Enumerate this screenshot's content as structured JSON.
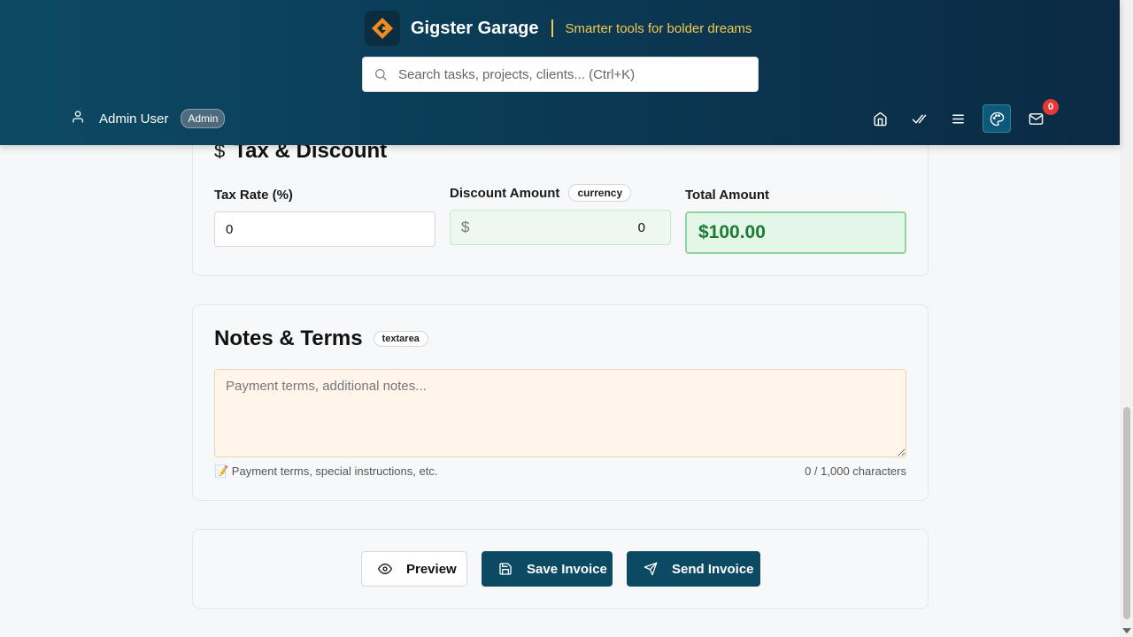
{
  "header": {
    "brand_name": "Gigster Garage",
    "tagline": "Smarter tools for bolder dreams",
    "search_placeholder": "Search tasks, projects, clients... (Ctrl+K)",
    "user_name": "Admin User",
    "role_badge": "Admin",
    "notification_count": "0",
    "nav_icons": [
      "home-icon",
      "tasks-check-icon",
      "menu-icon",
      "palette-icon",
      "mail-icon"
    ],
    "accent_color": "#f2c94c",
    "header_color": "#0b3954"
  },
  "tax_discount": {
    "title": "Tax & Discount",
    "tax_rate_label": "Tax Rate (%)",
    "tax_rate_value": "0",
    "discount_label": "Discount Amount",
    "discount_tag": "currency",
    "discount_currency": "$",
    "discount_value": "0",
    "total_label": "Total Amount",
    "total_value": "$100.00"
  },
  "notes": {
    "title": "Notes & Terms",
    "tag": "textarea",
    "placeholder": "Payment terms, additional notes...",
    "hint": "📝 Payment terms, special instructions, etc.",
    "counter": "0 / 1,000 characters"
  },
  "actions": {
    "preview_label": "Preview",
    "save_label": "Save Invoice",
    "send_label": "Send Invoice",
    "primary_color": "#0c4a63"
  }
}
